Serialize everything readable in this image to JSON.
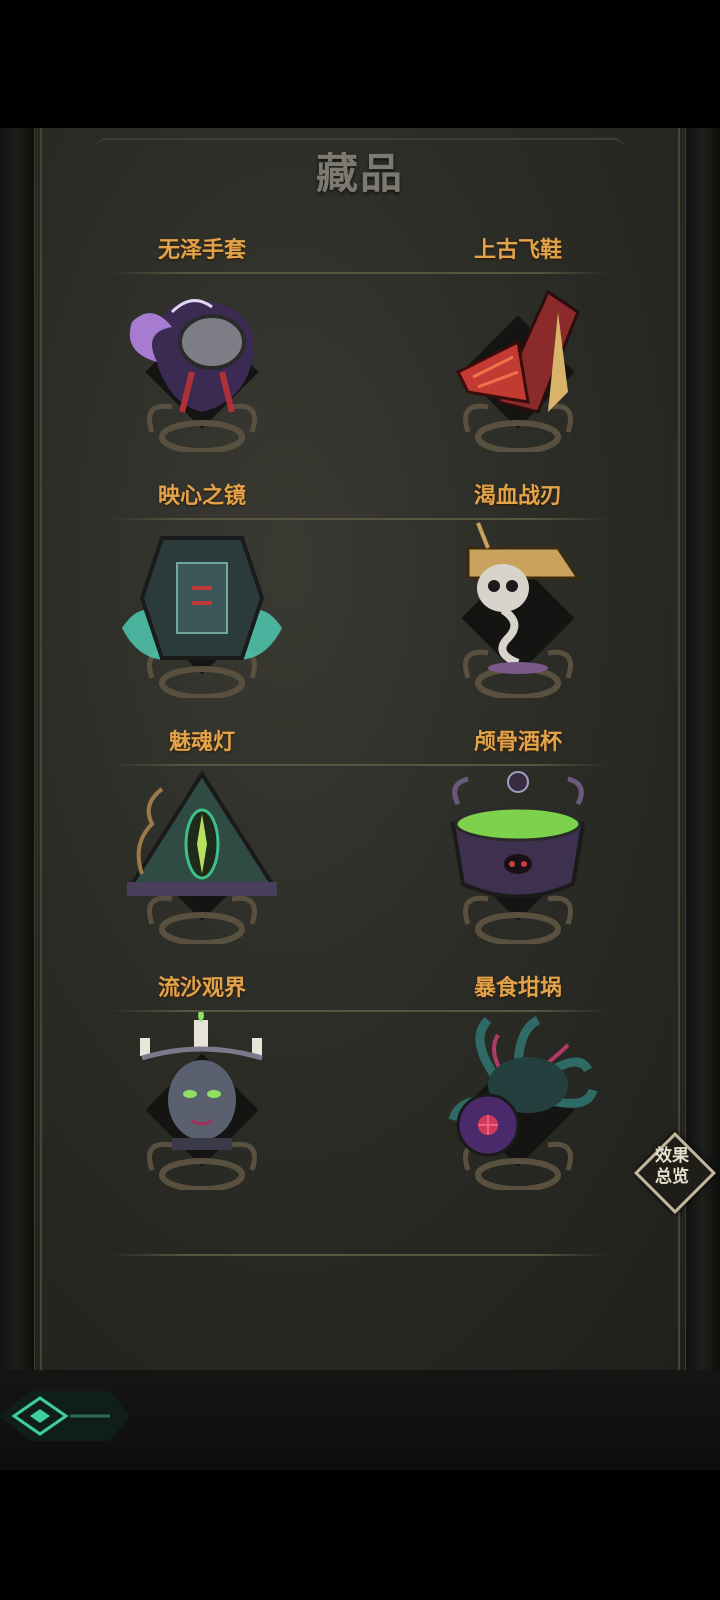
{
  "page": {
    "title": "藏品"
  },
  "items": [
    {
      "name": "无泽手套",
      "icon": "gauntlet-icon",
      "accent": "#a67bd0"
    },
    {
      "name": "上古飞鞋",
      "icon": "winged-boot-icon",
      "accent": "#c33a32"
    },
    {
      "name": "映心之镜",
      "icon": "mirror-icon",
      "accent": "#4fc9b0"
    },
    {
      "name": "渴血战刃",
      "icon": "skull-goblet-icon",
      "accent": "#c9a35e"
    },
    {
      "name": "魅魂灯",
      "icon": "eye-altar-icon",
      "accent": "#3fbf8a"
    },
    {
      "name": "颅骨酒杯",
      "icon": "cauldron-icon",
      "accent": "#7ed14a"
    },
    {
      "name": "流沙观界",
      "icon": "candelabra-icon",
      "accent": "#8fe060"
    },
    {
      "name": "暴食坩埚",
      "icon": "tentacle-orb-icon",
      "accent": "#d03a5a"
    }
  ],
  "effects_button": {
    "line1": "效果",
    "line2": "总览"
  },
  "colors": {
    "item_label": "#e3a34a",
    "title": "#7c7a70",
    "back_accent": "#3fcf9a"
  }
}
